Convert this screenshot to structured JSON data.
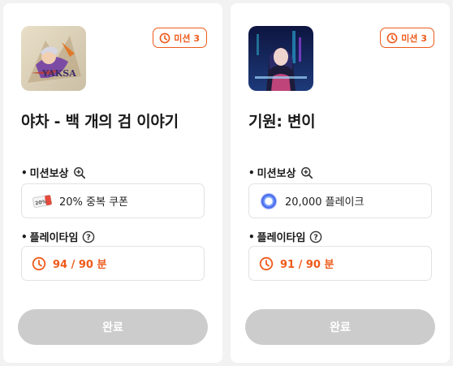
{
  "missions": [
    {
      "badge": "미션 3",
      "title": "야차 - 백 개의 검 이야기",
      "reward_label": "미션보상",
      "reward_text": "20% 중복 쿠폰",
      "playtime_label": "플레이타임",
      "playtime_value": "94 / 90 분",
      "button_label": "완료",
      "reward_icon": "coupon-icon",
      "button_state": "disabled"
    },
    {
      "badge": "미션 3",
      "title": "기원: 변이",
      "reward_label": "미션보상",
      "reward_text": "20,000 플레이크",
      "playtime_label": "플레이타임",
      "playtime_value": "91 / 90 분",
      "button_label": "완료",
      "reward_icon": "flake-ring-icon",
      "button_state": "disabled"
    }
  ],
  "colors": {
    "accent": "#ee5a1a",
    "disabled_button": "#cccccc",
    "card_background": "#ffffff",
    "page_background": "#f2f2f2"
  }
}
